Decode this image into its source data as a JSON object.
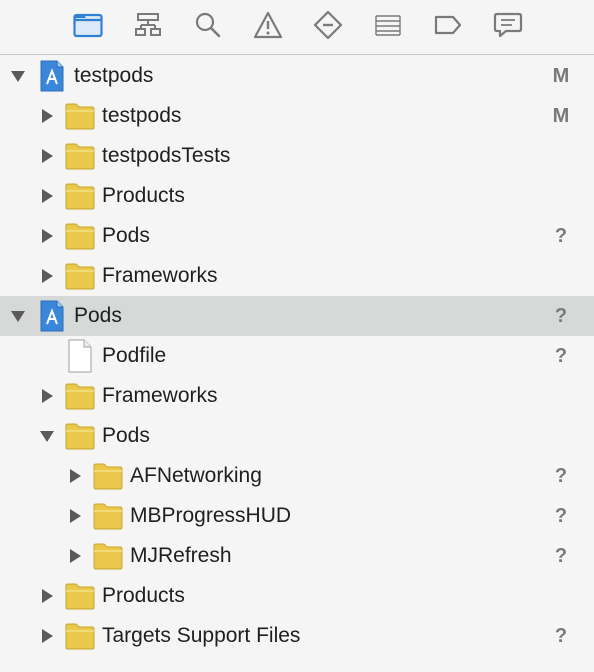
{
  "toolbar": {
    "icons": [
      {
        "name": "project-navigator-icon",
        "active": true
      },
      {
        "name": "symbol-navigator-icon"
      },
      {
        "name": "find-navigator-icon"
      },
      {
        "name": "issue-navigator-icon"
      },
      {
        "name": "test-navigator-icon"
      },
      {
        "name": "debug-navigator-icon"
      },
      {
        "name": "breakpoint-navigator-icon"
      },
      {
        "name": "report-navigator-icon"
      }
    ],
    "accent_color": "#2f7fd6"
  },
  "tree": {
    "rows": [
      {
        "label": "testpods",
        "status": "M"
      },
      {
        "label": "testpods",
        "status": "M"
      },
      {
        "label": "testpodsTests",
        "status": ""
      },
      {
        "label": "Products",
        "status": ""
      },
      {
        "label": "Pods",
        "status": "?"
      },
      {
        "label": "Frameworks",
        "status": ""
      },
      {
        "label": "Pods",
        "status": "?"
      },
      {
        "label": "Podfile",
        "status": "?"
      },
      {
        "label": "Frameworks",
        "status": ""
      },
      {
        "label": "Pods",
        "status": ""
      },
      {
        "label": "AFNetworking",
        "status": "?"
      },
      {
        "label": "MBProgressHUD",
        "status": "?"
      },
      {
        "label": "MJRefresh",
        "status": "?"
      },
      {
        "label": "Products",
        "status": ""
      },
      {
        "label": "Targets Support Files",
        "status": "?"
      }
    ]
  }
}
